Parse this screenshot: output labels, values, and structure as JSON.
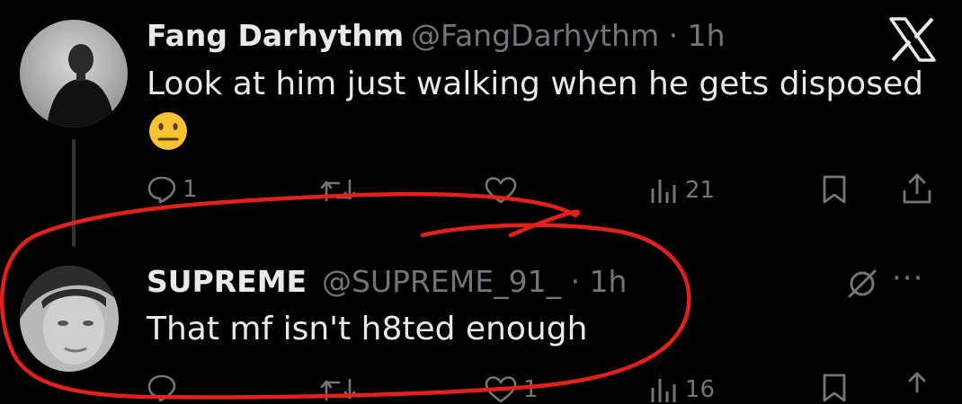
{
  "colors": {
    "background": "#000000",
    "text_primary": "#e7e9ea",
    "text_secondary": "#71767b",
    "thread_line": "#333639",
    "annotation_stroke": "#e3211c"
  },
  "header": {
    "logo_icon": "x-logo-icon"
  },
  "main_tweet": {
    "display_name": "Fang Darhythm",
    "meta": "@FangDarhythm · 1h",
    "text": "Look at him just walking when he gets disposed",
    "emoji": "😐",
    "actions": {
      "reply_icon": "reply-icon",
      "reply_count": "1",
      "retweet_icon": "retweet-icon",
      "like_icon": "heart-icon",
      "views_icon": "views-icon",
      "views_count": "21",
      "bookmark_icon": "bookmark-icon",
      "share_icon": "share-icon"
    }
  },
  "reply_tweet": {
    "display_name": "SUPREME",
    "meta": "@SUPREME_91_ · 1h",
    "text": "That mf isn't h8ted enough",
    "more_icon": "more-icon",
    "more_label": "···",
    "actions": {
      "reply_icon": "reply-icon",
      "retweet_icon": "retweet-icon",
      "like_icon": "heart-icon",
      "like_count": "1",
      "views_icon": "views-icon",
      "views_count": "16",
      "bookmark_icon": "bookmark-icon",
      "share_icon": "share-icon"
    }
  }
}
